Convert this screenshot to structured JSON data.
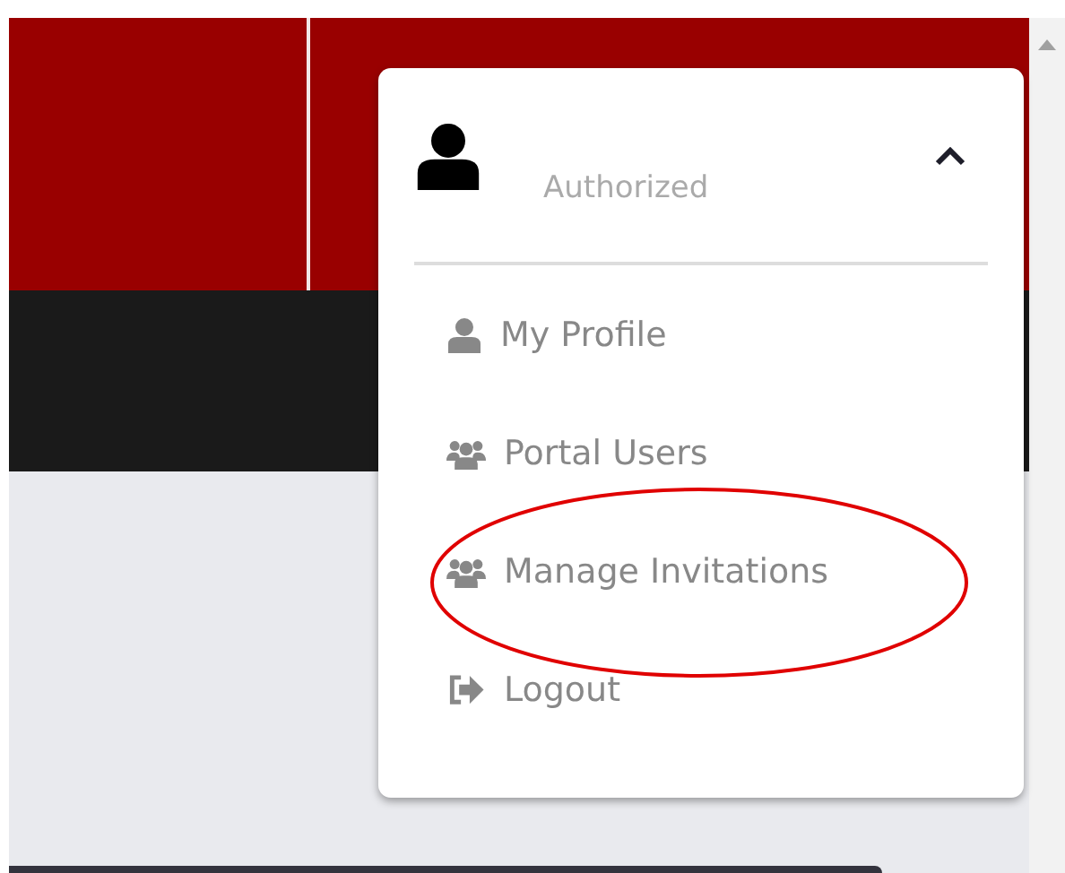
{
  "user_menu": {
    "status": "Authorized",
    "expanded": true,
    "items": [
      {
        "kind": "user",
        "label": "My Profile",
        "highlighted": false
      },
      {
        "kind": "users",
        "label": "Portal Users",
        "highlighted": false
      },
      {
        "kind": "users",
        "label": "Manage Invitations",
        "highlighted": true
      },
      {
        "kind": "logout",
        "label": "Logout",
        "highlighted": false
      }
    ]
  }
}
